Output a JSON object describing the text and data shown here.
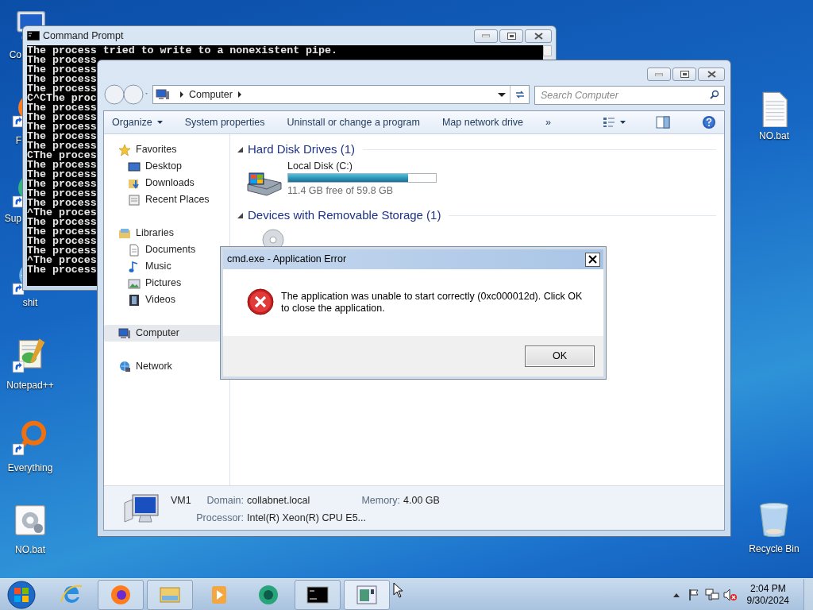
{
  "desktop_left": [
    {
      "kind": "computer",
      "label": "Co"
    },
    {
      "kind": "firefox",
      "label": "F"
    },
    {
      "kind": "app",
      "label": "Sup"
    },
    {
      "kind": "globe",
      "label": "shit"
    },
    {
      "kind": "notepad",
      "label": "Notepad++"
    },
    {
      "kind": "everything",
      "label": "Everything"
    },
    {
      "kind": "batch",
      "label": "NO.bat"
    }
  ],
  "desktop_right": [
    {
      "kind": "text-file",
      "label": "NO.bat"
    },
    {
      "kind": "recycle-bin",
      "label": "Recycle Bin"
    }
  ],
  "cmd": {
    "title": "Command Prompt",
    "lines": [
      "The process tried to write to a nonexistent pipe.",
      "The process",
      "The process",
      "The process",
      "The process",
      "C^CThe proc",
      "The process",
      "The process",
      "The process",
      "The process",
      "The process",
      "CThe proces",
      "The process",
      "The process",
      "The process",
      "The process",
      "The process",
      "^The proces",
      "The process",
      "The process",
      "The process",
      "The process",
      "^The proces",
      "The process"
    ]
  },
  "explorer": {
    "breadcrumb": [
      "Computer"
    ],
    "search": {
      "placeholder": "Search Computer"
    },
    "toolbar": [
      {
        "label": "Organize",
        "dropdown": true
      },
      {
        "label": "System properties",
        "dropdown": false
      },
      {
        "label": "Uninstall or change a program",
        "dropdown": false
      },
      {
        "label": "Map network drive",
        "dropdown": false
      },
      {
        "label": "»",
        "dropdown": false
      }
    ],
    "nav": [
      {
        "label": "Favorites",
        "kind": "star",
        "selected": false,
        "children": [
          {
            "label": "Desktop",
            "kind": "desktop",
            "selected": false
          },
          {
            "label": "Downloads",
            "kind": "downloads",
            "selected": false
          },
          {
            "label": "Recent Places",
            "kind": "recent",
            "selected": false
          }
        ]
      },
      {
        "label": "Libraries",
        "kind": "libraries",
        "selected": false,
        "children": [
          {
            "label": "Documents",
            "kind": "documents",
            "selected": false
          },
          {
            "label": "Music",
            "kind": "music",
            "selected": false
          },
          {
            "label": "Pictures",
            "kind": "pictures",
            "selected": false
          },
          {
            "label": "Videos",
            "kind": "videos",
            "selected": false
          }
        ]
      },
      {
        "label": "Computer",
        "kind": "computer",
        "selected": true
      },
      {
        "label": "Network",
        "kind": "network",
        "selected": false
      }
    ],
    "sections": [
      {
        "title": "Hard Disk Drives (1)",
        "items": [
          {
            "kind": "hard-disk",
            "name": "Local Disk (C:)",
            "level": 0.81,
            "free": "11.4 GB free of 59.8 GB"
          }
        ]
      },
      {
        "title": "Devices with Removable Storage (1)",
        "items": [
          {
            "kind": "optical-drive"
          }
        ]
      }
    ],
    "details": {
      "name": "VM1",
      "fields": [
        {
          "label": "Domain:",
          "value": "collabnet.local"
        },
        {
          "label": "Memory:",
          "value": "4.00 GB"
        },
        {
          "label": "Processor:",
          "value": "Intel(R) Xeon(R) CPU E5..."
        }
      ]
    }
  },
  "dialog": {
    "title": "cmd.exe - Application Error",
    "message": "The application was unable to start correctly (0xc000012d). Click OK to close the application.",
    "buttons": [
      "OK"
    ]
  },
  "taskbar": {
    "apps": [
      {
        "kind": "ie",
        "open": false,
        "selected": false
      },
      {
        "kind": "firefox",
        "open": true,
        "selected": false
      },
      {
        "kind": "folder",
        "open": true,
        "selected": false
      },
      {
        "kind": "media",
        "open": false,
        "selected": false
      },
      {
        "kind": "swirl",
        "open": false,
        "selected": false
      },
      {
        "kind": "cmd",
        "open": true,
        "selected": false
      },
      {
        "kind": "window",
        "open": true,
        "selected": true
      }
    ],
    "time": "2:04 PM",
    "date": "9/30/2024"
  }
}
